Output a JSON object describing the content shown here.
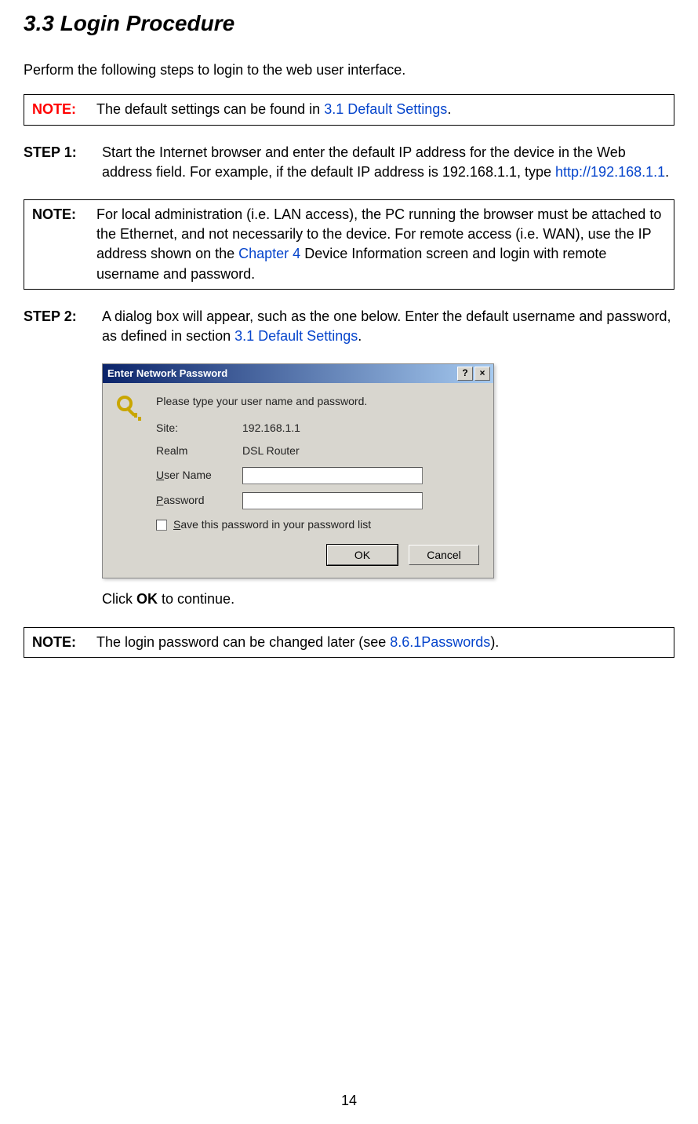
{
  "section": {
    "title": "3.3 Login Procedure",
    "intro": "Perform the following steps to login to the web user interface."
  },
  "note1": {
    "label": "NOTE:",
    "text_a": "The default settings can be found in ",
    "link": "3.1 Default Settings",
    "text_b": "."
  },
  "step1": {
    "label": "STEP 1:",
    "text_a": "Start the Internet browser and enter the default IP address for the device in the Web address field. For example, if the default IP address is 192.168.1.1, type ",
    "link": "http://192.168.1.1",
    "text_b": "."
  },
  "note2": {
    "label": "NOTE:",
    "text_a": "For local administration (i.e. LAN access), the PC running the browser must be attached to the Ethernet, and not necessarily to the device. For remote access (i.e. WAN), use the IP address shown on the ",
    "link": "Chapter 4",
    "text_b": " Device Information screen and login with remote username and password."
  },
  "step2": {
    "label": "STEP 2:",
    "text_a": "A dialog box will appear, such as the one below.   Enter the default username and password, as defined in section ",
    "link": "3.1 Default Settings",
    "text_b": "."
  },
  "dialog": {
    "title": "Enter Network Password",
    "help_btn": "?",
    "close_btn": "×",
    "prompt": "Please type your user name and password.",
    "site_label": "Site:",
    "site_value": "192.168.1.1",
    "realm_label": "Realm",
    "realm_value": "DSL Router",
    "username_prefix": "U",
    "username_rest": "ser Name",
    "password_prefix": "P",
    "password_rest": "assword",
    "save_prefix": "S",
    "save_rest": "ave this password in your password list",
    "ok": "OK",
    "cancel": "Cancel"
  },
  "click_ok": {
    "pre": "Click ",
    "bold": "OK",
    "post": " to continue."
  },
  "note3": {
    "label": "NOTE:",
    "text_a": "The login password can be changed later (see ",
    "link": "8.6.1Passwords",
    "text_b": ")."
  },
  "page_number": "14"
}
